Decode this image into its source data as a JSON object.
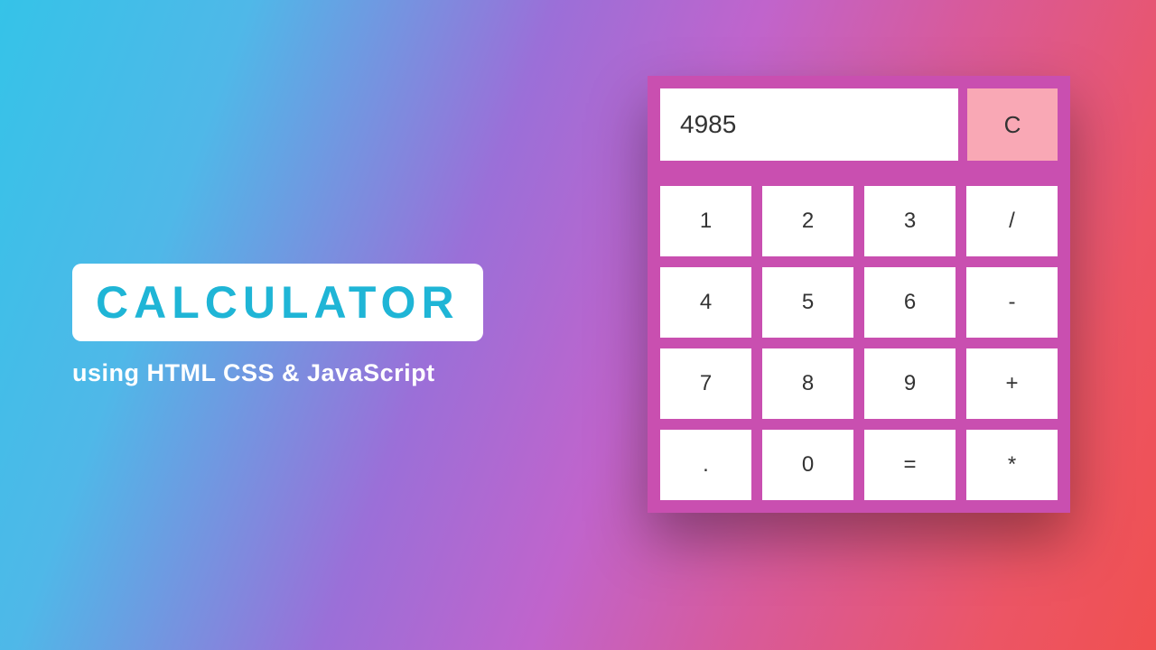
{
  "title": "CALCULATOR",
  "subtitle": "using HTML CSS & JavaScript",
  "display": "4985",
  "clear": "C",
  "keys": [
    "1",
    "2",
    "3",
    "/",
    "4",
    "5",
    "6",
    "-",
    "7",
    "8",
    "9",
    "+",
    ".",
    "0",
    "=",
    "*"
  ]
}
